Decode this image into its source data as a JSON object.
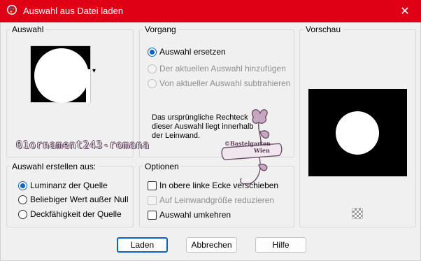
{
  "window": {
    "title": "Auswahl aus Datei laden",
    "close_glyph": "✕",
    "app_icon": "psp-palette-icon"
  },
  "auswahl": {
    "legend": "Auswahl",
    "dropdown_glyph": "▾"
  },
  "vorgang": {
    "legend": "Vorgang",
    "options": [
      {
        "label": "Auswahl ersetzen",
        "selected": true,
        "enabled": true
      },
      {
        "label": "Der aktuellen Auswahl hinzufügen",
        "selected": false,
        "enabled": false
      },
      {
        "label": "Von aktueller Auswahl subtrahieren",
        "selected": false,
        "enabled": false
      }
    ],
    "note": "Das ursprüngliche Rechteck dieser Auswahl liegt innerhalb der Leinwand."
  },
  "vorschau": {
    "legend": "Vorschau",
    "zoom_icon": "checkerboard-icon"
  },
  "erstellen": {
    "legend": "Auswahl erstellen aus:",
    "options": [
      {
        "label": "Luminanz der Quelle",
        "selected": true
      },
      {
        "label": "Beliebiger Wert außer Null",
        "selected": false
      },
      {
        "label": "Deckfähigkeit der Quelle",
        "selected": false
      }
    ]
  },
  "optionen": {
    "legend": "Optionen",
    "checks": [
      {
        "label": "In obere linke Ecke verschieben",
        "checked": false,
        "enabled": true
      },
      {
        "label": "Auf Leinwandgröße reduzieren",
        "checked": false,
        "enabled": false
      },
      {
        "label": "Auswahl umkehren",
        "checked": false,
        "enabled": true
      }
    ]
  },
  "buttons": {
    "laden": "Laden",
    "abbrechen": "Abbrechen",
    "hilfe": "Hilfe"
  },
  "overlay": {
    "watermark": "01ornament243-romana",
    "stamp_line1": "©Bastelgarten",
    "stamp_line2": "Wien"
  },
  "colors": {
    "titlebar": "#e00016",
    "accent": "#0a64c8",
    "watermark_outline": "#5a3a55"
  }
}
